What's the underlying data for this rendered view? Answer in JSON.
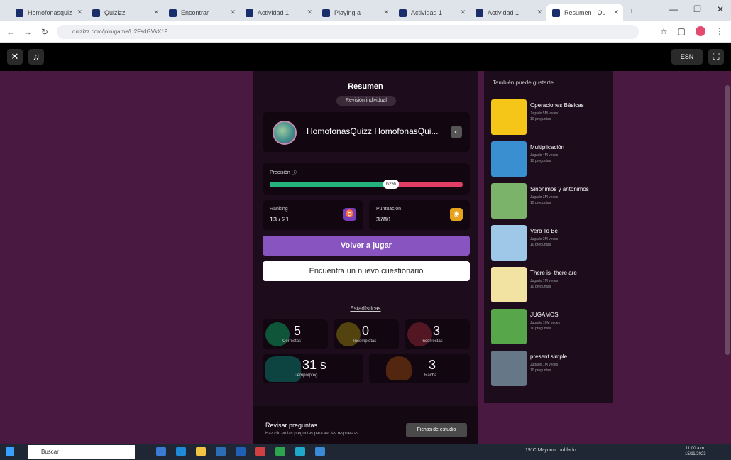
{
  "browser": {
    "tabs": [
      {
        "label": "Homofonasquiz"
      },
      {
        "label": "Quizizz"
      },
      {
        "label": "Encontrar"
      },
      {
        "label": "Actividad 1"
      },
      {
        "label": "Playing a"
      },
      {
        "label": "Actividad 1"
      },
      {
        "label": "Actividad 1"
      },
      {
        "label": "Resumen - Qu"
      }
    ],
    "url": "quizizz.com/join/game/U2FsdGVkX19..."
  },
  "appbar": {
    "language_label": "ESN"
  },
  "summary": {
    "title": "Resumen",
    "individual_pill": "Revisión individual",
    "player_name": "HomofonasQuizz HomofonasQui...",
    "precision": {
      "label": "Precisión",
      "percent": 62,
      "badge": "62%"
    },
    "ranking": {
      "label": "Ranking",
      "value": "13 / 21"
    },
    "score": {
      "label": "Puntuación",
      "value": "3780"
    },
    "play_again": "Volver a jugar",
    "find_new": "Encuentra un nuevo cuestionario",
    "stats_title": "Estadísticas",
    "stats": {
      "correct": {
        "value": "5",
        "label": "Correctas"
      },
      "incorrect": {
        "value": "0",
        "label": "Incompletas"
      },
      "unanswered": {
        "value": "3",
        "label": "Incorrectas"
      },
      "time": {
        "value": "31 s",
        "label": "Tiempo/preg."
      },
      "streak": {
        "value": "3",
        "label": "Racha"
      }
    },
    "review": {
      "title": "Revisar preguntas",
      "subtitle": "Haz clic en las preguntas para ver las respuestas",
      "cards_button": "Fichas de estudio"
    }
  },
  "suggestions": {
    "title": "También puede gustarte...",
    "items": [
      {
        "title": "Operaciones Básicas",
        "meta1": "Jugado 5M veces",
        "meta2": "10 preguntas",
        "color": "#f5c518"
      },
      {
        "title": "Multiplicación",
        "meta1": "Jugado 4M veces",
        "meta2": "10 preguntas",
        "color": "#3a8fd1"
      },
      {
        "title": "Sinónimos y antónimos",
        "meta1": "Jugado 3M veces",
        "meta2": "10 preguntas",
        "color": "#7bb36b"
      },
      {
        "title": "Verb To Be",
        "meta1": "Jugado 2M veces",
        "meta2": "10 preguntas",
        "color": "#9ec7e8"
      },
      {
        "title": "There is- there are",
        "meta1": "Jugado 1M veces",
        "meta2": "10 preguntas",
        "color": "#f3e3a3"
      },
      {
        "title": "JUGAMOS",
        "meta1": "Jugado 10M veces",
        "meta2": "10 preguntas",
        "color": "#58a64a"
      },
      {
        "title": "present simple",
        "meta1": "Jugado 1M veces",
        "meta2": "10 preguntas",
        "color": "#667788"
      }
    ]
  },
  "taskbar": {
    "search_placeholder": "Buscar",
    "tray_text": "19°C Mayorm. nublado",
    "clock_time": "11:00 a.m.",
    "clock_date": "15/11/2023"
  }
}
